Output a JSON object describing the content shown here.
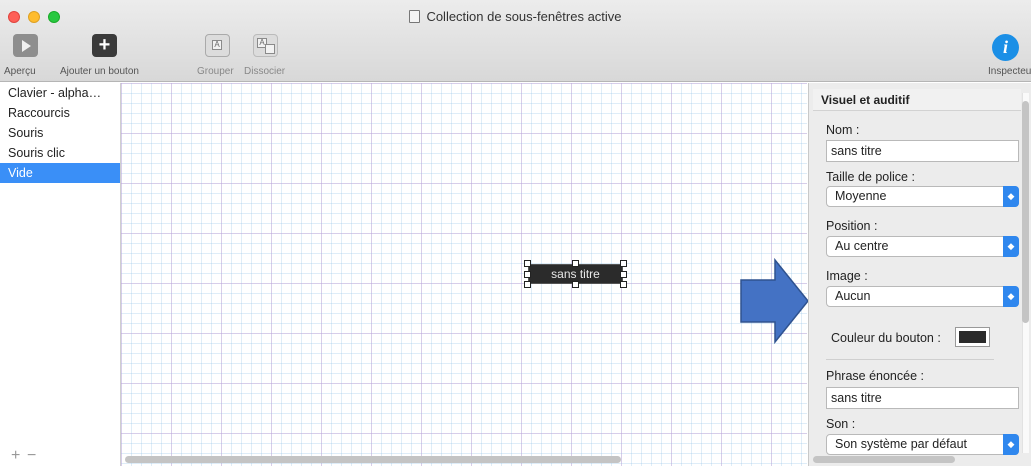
{
  "window": {
    "title": "Collection de sous-fenêtres active"
  },
  "toolbar": {
    "apercu_label": "Aperçu",
    "ajouter_label": "Ajouter un bouton",
    "grouper_label": "Grouper",
    "dissocier_label": "Dissocier",
    "inspecteur_label": "Inspecteur"
  },
  "sidebar": {
    "items": [
      {
        "label": "Clavier - alpha…",
        "selected": false
      },
      {
        "label": "Raccourcis",
        "selected": false
      },
      {
        "label": "Souris",
        "selected": false
      },
      {
        "label": "Souris clic",
        "selected": false
      },
      {
        "label": "Vide",
        "selected": true
      }
    ],
    "add_symbol": "+",
    "remove_symbol": "−"
  },
  "canvas": {
    "button_label": "sans titre"
  },
  "inspector": {
    "header": "Visuel et auditif",
    "nom_label": "Nom :",
    "nom_value": "sans titre",
    "taille_label": "Taille de police :",
    "taille_value": "Moyenne",
    "position_label": "Position :",
    "position_value": "Au centre",
    "image_label": "Image :",
    "image_value": "Aucun",
    "couleur_label": "Couleur du bouton :",
    "couleur_value": "#2b2b2b",
    "phrase_label": "Phrase énoncée :",
    "phrase_value": "sans titre",
    "son_label": "Son :",
    "son_value": "Son système par défaut"
  },
  "colors": {
    "accent": "#2f87ee",
    "selection": "#3a8ff7",
    "arrow": "#4472c4"
  },
  "icons": [
    "play-icon",
    "plus-icon",
    "group-icon",
    "ungroup-icon",
    "info-icon",
    "document-icon",
    "chevron-updown-icon",
    "right-arrow-icon"
  ]
}
